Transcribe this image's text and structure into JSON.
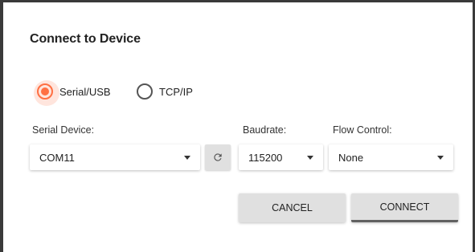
{
  "dialog": {
    "title": "Connect to Device"
  },
  "connection_type": {
    "options": [
      {
        "label": "Serial/USB",
        "selected": true
      },
      {
        "label": "TCP/IP",
        "selected": false
      }
    ]
  },
  "fields": {
    "serial_device": {
      "label": "Serial Device:",
      "value": "COM11"
    },
    "baudrate": {
      "label": "Baudrate:",
      "value": "115200"
    },
    "flow_control": {
      "label": "Flow Control:",
      "value": "None"
    }
  },
  "icons": {
    "refresh": "refresh-icon",
    "dropdown": "chevron-down-icon"
  },
  "buttons": {
    "cancel": "CANCEL",
    "connect": "CONNECT"
  },
  "colors": {
    "accent": "#ff7043",
    "button_bg": "#e0e0e0",
    "primary_underline": "#616161"
  }
}
